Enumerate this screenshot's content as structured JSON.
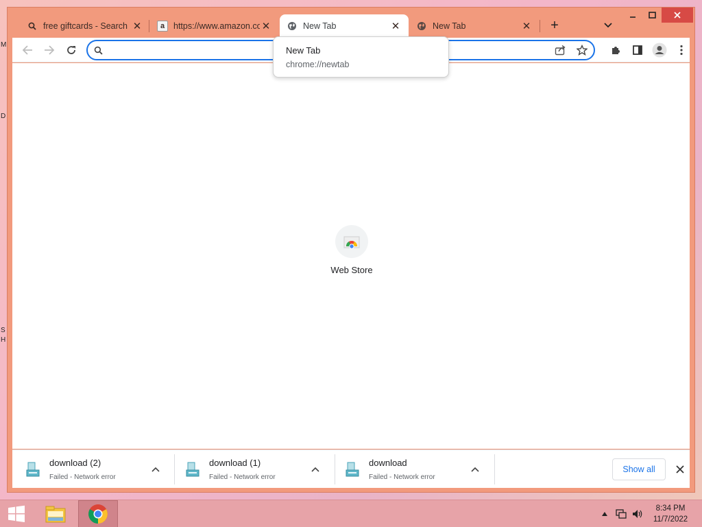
{
  "desktop": {
    "edge_labels": [
      "M",
      "D",
      "S",
      "H"
    ]
  },
  "tabs": [
    {
      "label": "free giftcards - Search",
      "favicon": "search-icon"
    },
    {
      "label": "https://www.amazon.com",
      "favicon": "amazon-icon"
    },
    {
      "label": "New Tab",
      "favicon": "globe-icon",
      "active": true
    },
    {
      "label": "New Tab",
      "favicon": "globe-icon"
    }
  ],
  "tooltip": {
    "title": "New Tab",
    "url": "chrome://newtab"
  },
  "omnibox": {
    "value": "",
    "placeholder": ""
  },
  "shortcut": {
    "label": "Web Store"
  },
  "downloads": [
    {
      "name": "download (2)",
      "status": "Failed - Network error"
    },
    {
      "name": "download (1)",
      "status": "Failed - Network error"
    },
    {
      "name": "download",
      "status": "Failed - Network error"
    }
  ],
  "shelf": {
    "show_all_label": "Show all"
  },
  "clock": {
    "time": "8:34 PM",
    "date": "11/7/2022"
  },
  "colors": {
    "frame": "#f29a7d",
    "accent": "#1a73e8",
    "close_red": "#d74a45"
  }
}
